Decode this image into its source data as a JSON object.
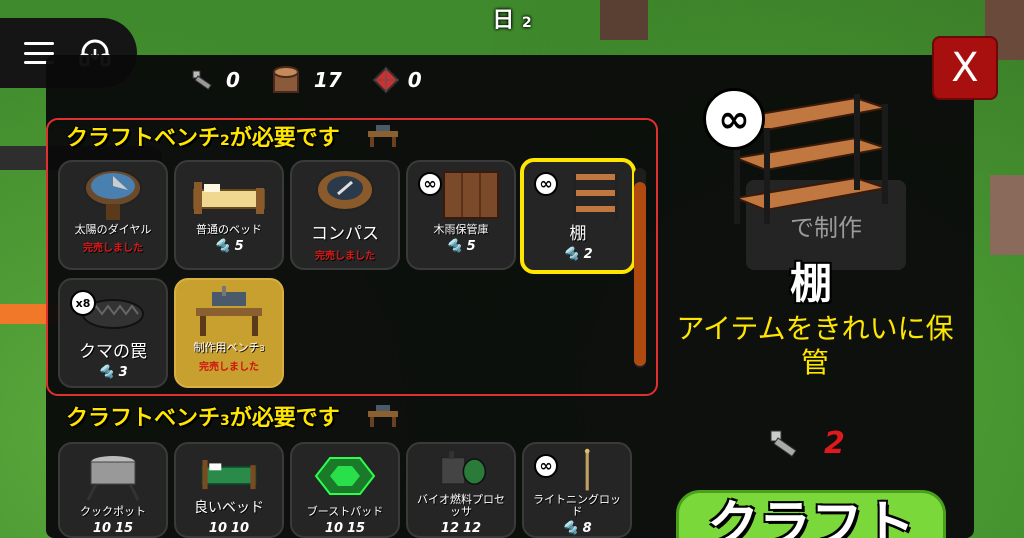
{
  "hud": {
    "day_label": "日",
    "day_number": "2"
  },
  "resources": [
    {
      "icon": "bolt-icon",
      "value": "0"
    },
    {
      "icon": "log-icon",
      "value": "17"
    },
    {
      "icon": "gem-icon",
      "value": "0"
    }
  ],
  "close_label": "X",
  "sections": [
    {
      "title": "クラフトベンチ",
      "title_sub": "2",
      "title_suffix": "が必要です"
    },
    {
      "title": "クラフトベンチ",
      "title_sub": "3",
      "title_suffix": "が必要です"
    }
  ],
  "sold_text": "完売しました",
  "items_section1": [
    {
      "name": "太陽のダイヤル",
      "status": "sold"
    },
    {
      "name": "普通のベッド",
      "cost": "5"
    },
    {
      "name": "コンパス",
      "status": "sold"
    },
    {
      "name": "木雨保管庫",
      "cost": "5",
      "badge": "∞"
    },
    {
      "name": "棚",
      "cost": "2",
      "badge": "∞",
      "selected": true
    },
    {
      "name": "クマの罠",
      "cost": "3",
      "badge": "x8"
    },
    {
      "name": "制作用ベンチ",
      "name_sub": "3",
      "status": "sold"
    }
  ],
  "items_section2": [
    {
      "name": "クックポット",
      "cost": [
        "10",
        "15"
      ]
    },
    {
      "name": "良いベッド",
      "cost": [
        "10",
        "10"
      ]
    },
    {
      "name": "ブーストパッド",
      "cost": [
        "10",
        "15"
      ]
    },
    {
      "name": "バイオ燃料プロセッサ",
      "cost": [
        "12",
        "12"
      ]
    },
    {
      "name": "ライトニングロッド",
      "cost": "8",
      "badge": "∞"
    }
  ],
  "detail": {
    "badge": "∞",
    "title": "棚",
    "description": "アイテムをきれいに保管",
    "cost": "2",
    "craft_label": "クラフト",
    "ghost_text": "で制作"
  },
  "colors": {
    "accent_yellow": "#ffe600",
    "close_red": "#a80f0f",
    "craft_green": "#7bd83a",
    "sold_red": "#e01a1a"
  }
}
